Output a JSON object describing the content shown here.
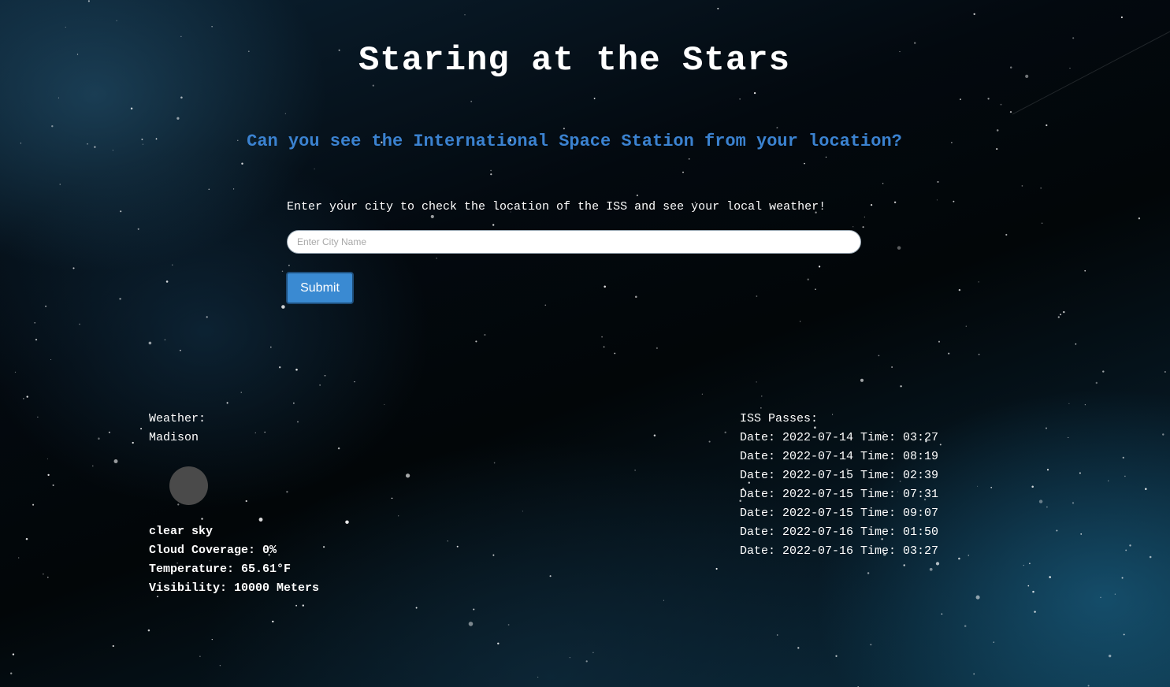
{
  "header": {
    "title": "Staring at the Stars",
    "subtitle": "Can you see the International Space Station from your location?"
  },
  "search": {
    "prompt": "Enter your city to check the location of the ISS and see your local weather!",
    "placeholder": "Enter City Name",
    "value": "",
    "submit_label": "Submit"
  },
  "weather": {
    "heading": "Weather:",
    "city": "Madison",
    "icon": "weather-icon",
    "description": "clear sky",
    "cloud_coverage": "Cloud Coverage: 0%",
    "temperature": "Temperature: 65.61°F",
    "visibility": "Visibility: 10000 Meters"
  },
  "iss": {
    "heading": "ISS Passes:",
    "passes": [
      "Date: 2022-07-14 Time: 03:27",
      "Date: 2022-07-14 Time: 08:19",
      "Date: 2022-07-15 Time: 02:39",
      "Date: 2022-07-15 Time: 07:31",
      "Date: 2022-07-15 Time: 09:07",
      "Date: 2022-07-16 Time: 01:50",
      "Date: 2022-07-16 Time: 03:27"
    ]
  },
  "colors": {
    "accent": "#3b82d0",
    "button": "#3a8ad2",
    "text": "#ffffff"
  }
}
